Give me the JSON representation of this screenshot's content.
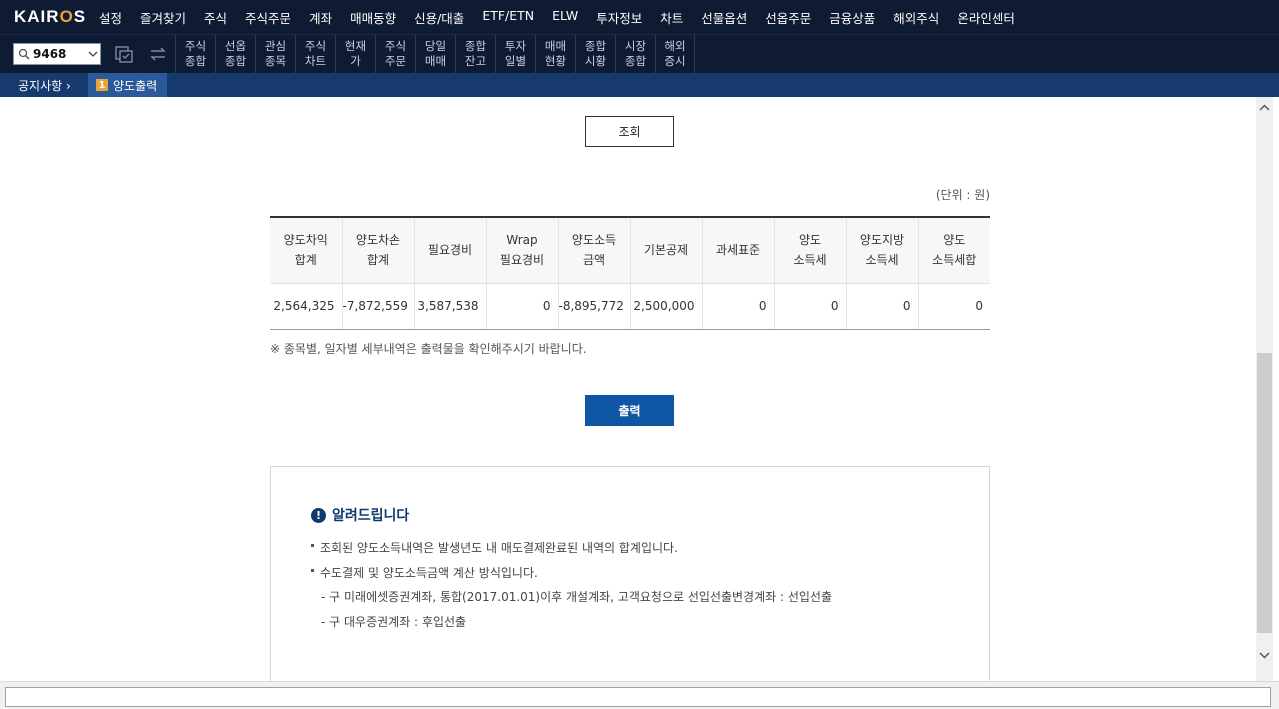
{
  "app": {
    "logo_prefix": "KAIR",
    "logo_o": "O",
    "logo_suffix": "S"
  },
  "menu": [
    "설정",
    "즐겨찾기",
    "주식",
    "주식주문",
    "계좌",
    "매매동향",
    "신용/대출",
    "ETF/ETN",
    "ELW",
    "투자정보",
    "차트",
    "선물옵션",
    "선옵주문",
    "금융상품",
    "해외주식",
    "온라인센터"
  ],
  "toolbar": {
    "stock_code": "9468",
    "quick": [
      {
        "l1": "주식",
        "l2": "종합"
      },
      {
        "l1": "선옵",
        "l2": "종합"
      },
      {
        "l1": "관심",
        "l2": "종목"
      },
      {
        "l1": "주식",
        "l2": "차트"
      },
      {
        "l1": "현재",
        "l2": "가"
      },
      {
        "l1": "주식",
        "l2": "주문"
      },
      {
        "l1": "당일",
        "l2": "매매"
      },
      {
        "l1": "종합",
        "l2": "잔고"
      },
      {
        "l1": "투자",
        "l2": "일별"
      },
      {
        "l1": "매매",
        "l2": "현황"
      },
      {
        "l1": "종합",
        "l2": "시황"
      },
      {
        "l1": "시장",
        "l2": "종합"
      },
      {
        "l1": "해외",
        "l2": "증시"
      }
    ]
  },
  "tabs": {
    "notice": "공지사항",
    "active_num": "1",
    "active_label": "양도출력"
  },
  "main": {
    "search_button": "조회",
    "unit": "(단위 : 원)",
    "headers": [
      {
        "l1": "양도차익",
        "l2": "합계"
      },
      {
        "l1": "양도차손",
        "l2": "합계"
      },
      {
        "l1": "필요경비",
        "l2": ""
      },
      {
        "l1": "Wrap",
        "l2": "필요경비"
      },
      {
        "l1": "양도소득",
        "l2": "금액"
      },
      {
        "l1": "기본공제",
        "l2": ""
      },
      {
        "l1": "과세표준",
        "l2": ""
      },
      {
        "l1": "양도",
        "l2": "소득세"
      },
      {
        "l1": "양도지방",
        "l2": "소득세"
      },
      {
        "l1": "양도",
        "l2": "소득세합"
      }
    ],
    "values": [
      "2,564,325",
      "-7,872,559",
      "3,587,538",
      "0",
      "-8,895,772",
      "2,500,000",
      "0",
      "0",
      "0",
      "0"
    ],
    "note": "※ 종목별, 일자별 세부내역은 출력물을 확인해주시기 바랍니다.",
    "print_button": "출력"
  },
  "info": {
    "title": "알려드립니다",
    "line1": "조회된 양도소득내역은 발생년도 내 매도결제완료된 내역의 합계입니다.",
    "line2": "수도결제 및 양도소득금액 계산 방식입니다.",
    "line3": "- 구 미래에셋증권계좌, 통합(2017.01.01)이후 개설계좌, 고객요청으로 선입선출변경계좌 : 선입선출",
    "line4": "- 구 대우증권계좌 : 후입선출"
  },
  "colors": {
    "menubar": "#0f1a33",
    "tabbar": "#173a6e",
    "accent": "#e8a33a",
    "primary_button": "#0f57a4"
  }
}
